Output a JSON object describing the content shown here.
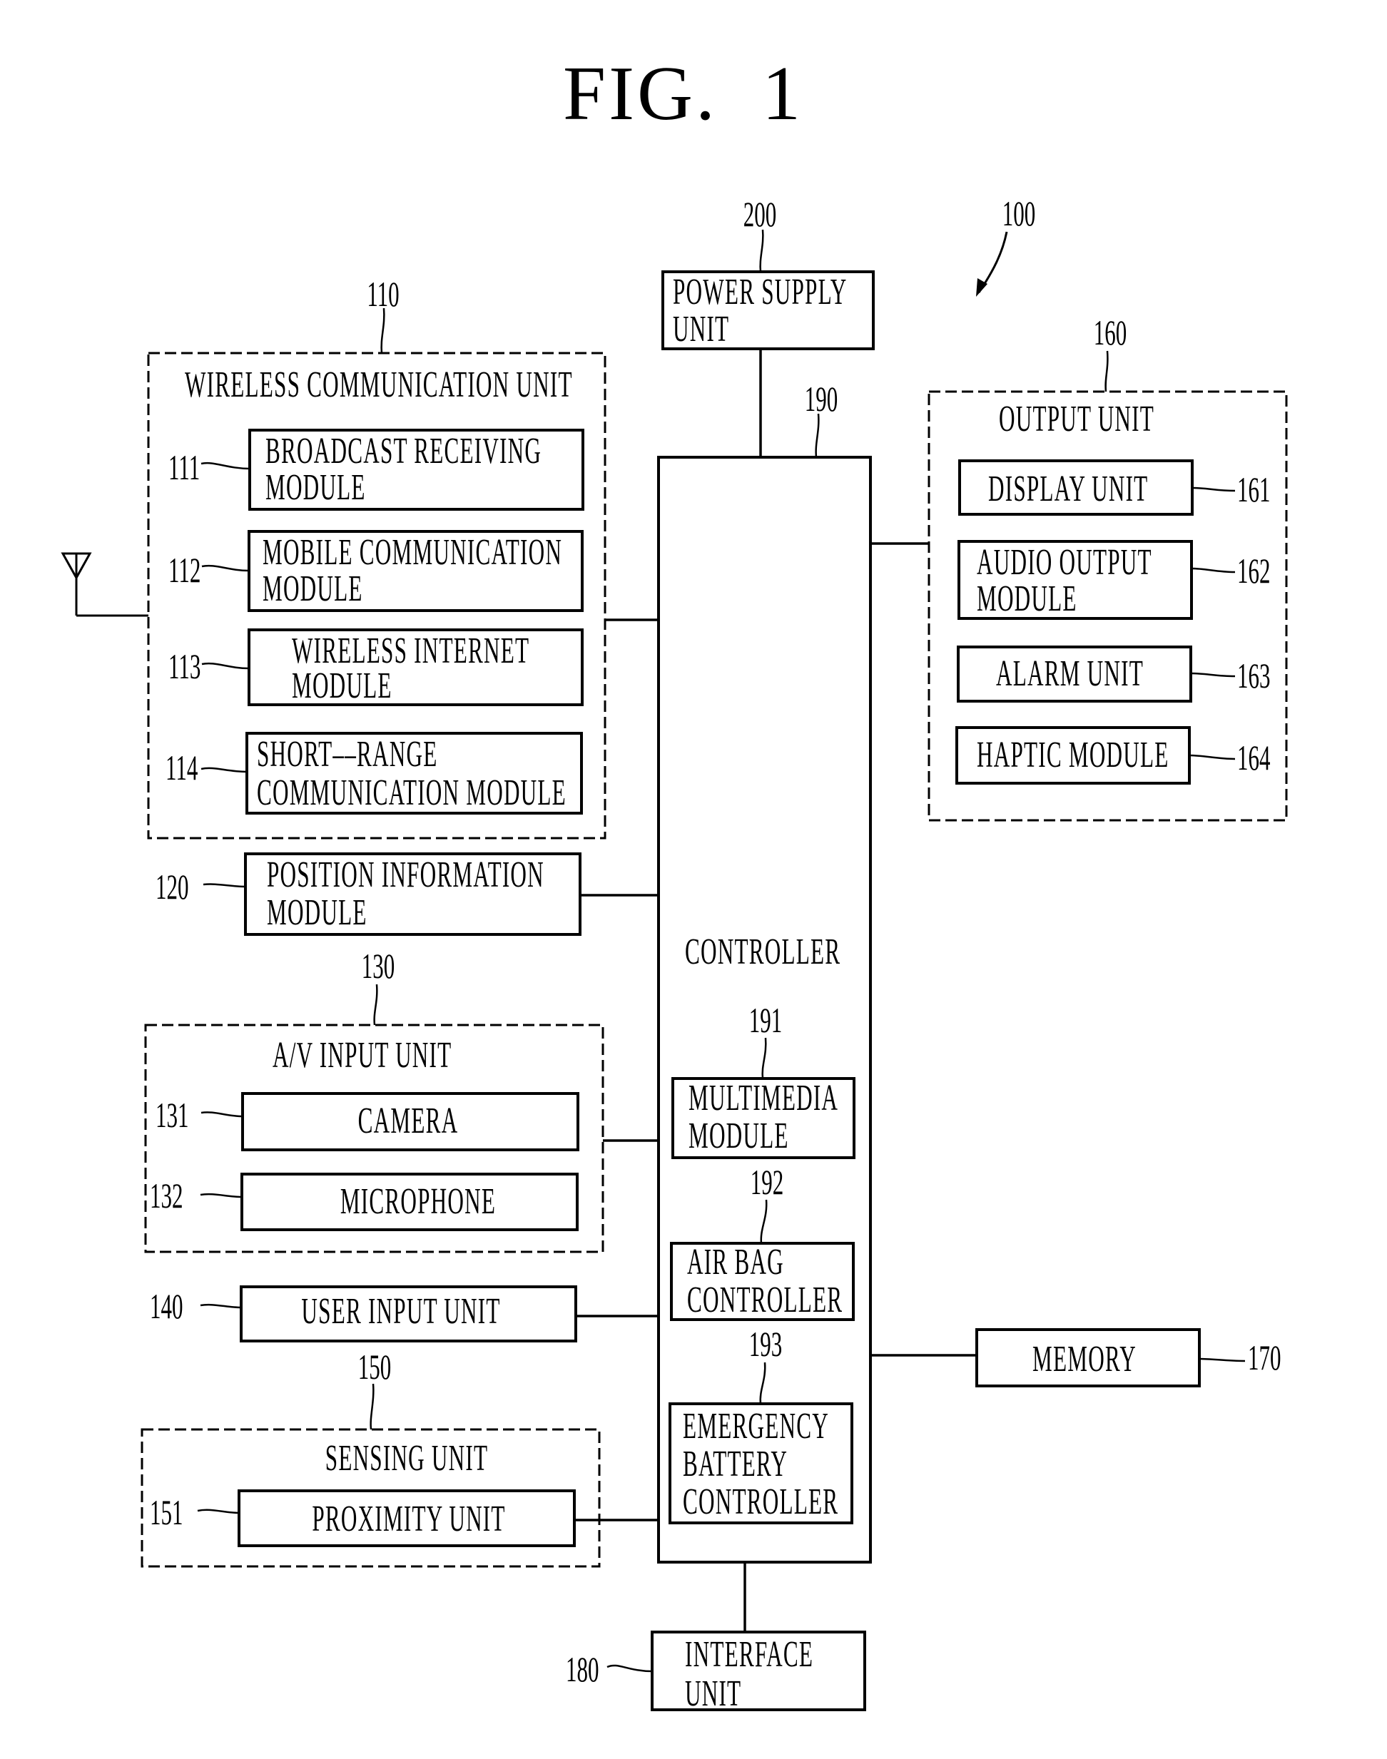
{
  "figure": {
    "title": "FIG.  1"
  },
  "device": {
    "ref": "100"
  },
  "power_supply": {
    "ref": "200",
    "lines": [
      "POWER SUPPLY",
      "UNIT"
    ]
  },
  "controller": {
    "ref": "190",
    "label": "CONTROLLER",
    "modules": [
      {
        "ref": "191",
        "lines": [
          "MULTIMEDIA",
          "MODULE"
        ]
      },
      {
        "ref": "192",
        "lines": [
          "AIR BAG",
          "CONTROLLER"
        ]
      },
      {
        "ref": "193",
        "lines": [
          "EMERGENCY",
          "BATTERY",
          "CONTROLLER"
        ]
      }
    ]
  },
  "wireless_unit": {
    "ref": "110",
    "title": "WIRELESS COMMUNICATION UNIT",
    "modules": [
      {
        "ref": "111",
        "lines": [
          "BROADCAST RECEIVING",
          "MODULE"
        ]
      },
      {
        "ref": "112",
        "lines": [
          "MOBILE COMMUNICATION",
          "MODULE"
        ]
      },
      {
        "ref": "113",
        "lines": [
          "WIRELESS INTERNET",
          "MODULE"
        ]
      },
      {
        "ref": "114",
        "lines": [
          "SHORT––RANGE",
          "COMMUNICATION MODULE"
        ]
      }
    ]
  },
  "position_module": {
    "ref": "120",
    "lines": [
      "POSITION INFORMATION",
      "MODULE"
    ]
  },
  "av_input_unit": {
    "ref": "130",
    "title": "A/V INPUT UNIT",
    "modules": [
      {
        "ref": "131",
        "label": "CAMERA"
      },
      {
        "ref": "132",
        "label": "MICROPHONE"
      }
    ]
  },
  "user_input_unit": {
    "ref": "140",
    "label": "USER INPUT UNIT"
  },
  "sensing_unit": {
    "ref": "150",
    "title": "SENSING UNIT",
    "modules": [
      {
        "ref": "151",
        "label": "PROXIMITY UNIT"
      }
    ]
  },
  "output_unit": {
    "ref": "160",
    "title": "OUTPUT UNIT",
    "modules": [
      {
        "ref": "161",
        "lines": [
          "DISPLAY UNIT"
        ]
      },
      {
        "ref": "162",
        "lines": [
          "AUDIO OUTPUT",
          "MODULE"
        ]
      },
      {
        "ref": "163",
        "lines": [
          "ALARM UNIT"
        ]
      },
      {
        "ref": "164",
        "lines": [
          "HAPTIC MODULE"
        ]
      }
    ]
  },
  "memory": {
    "ref": "170",
    "label": "MEMORY"
  },
  "interface_unit": {
    "ref": "180",
    "lines": [
      "INTERFACE",
      "UNIT"
    ]
  },
  "antenna": {
    "icon": "antenna-icon"
  }
}
